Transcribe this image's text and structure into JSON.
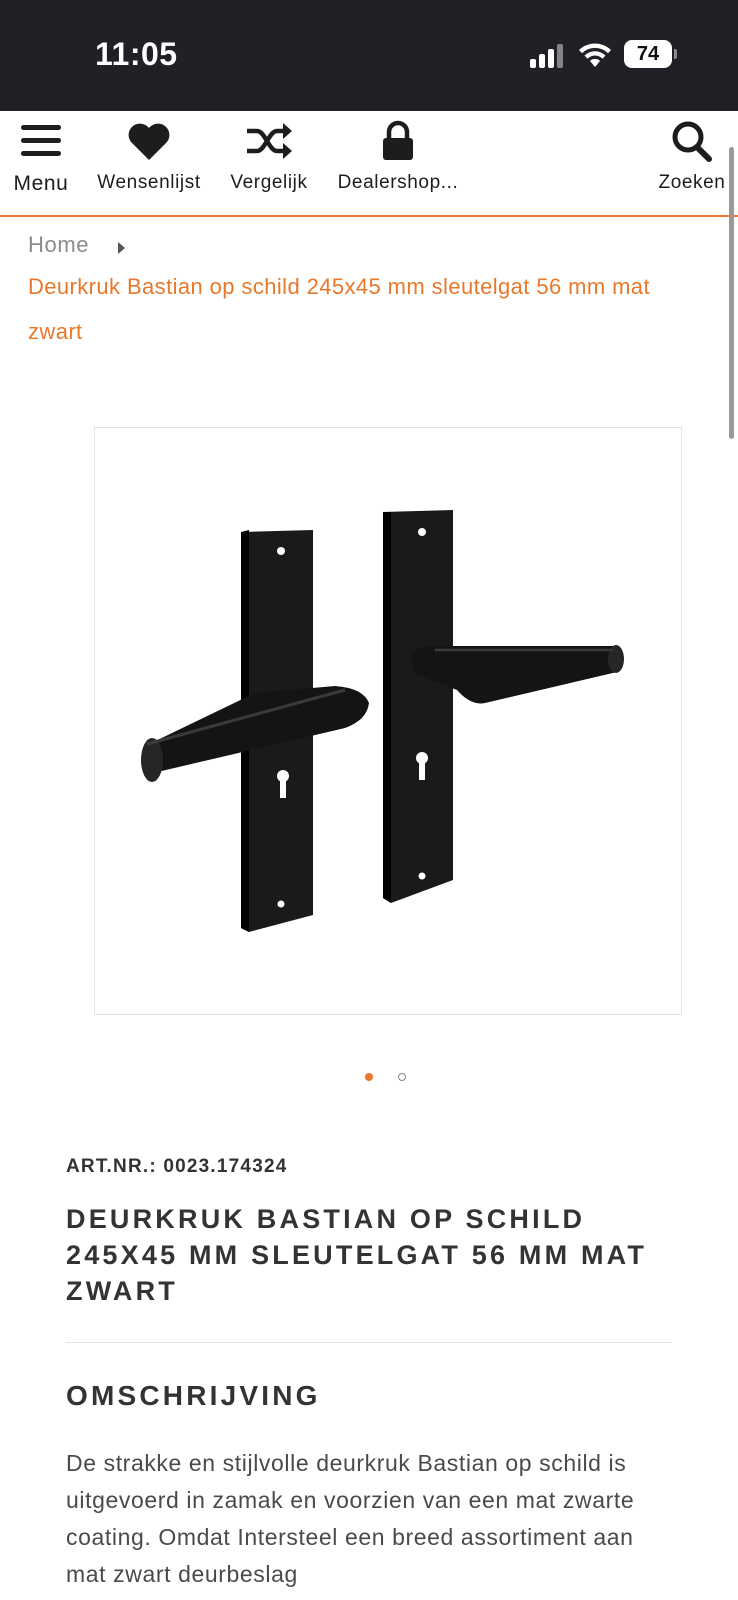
{
  "status_bar": {
    "time": "11:05",
    "battery": "74"
  },
  "nav": {
    "menu": "Menu",
    "wishlist": "Wensenlijst",
    "compare": "Vergelijk",
    "dealershop": "Dealershop...",
    "search": "Zoeken"
  },
  "breadcrumb": {
    "home": "Home",
    "current": "Deurkruk Bastian op schild 245x45 mm sleutelgat 56 mm mat zwart"
  },
  "gallery": {
    "slide_count": 2,
    "active_slide": 1
  },
  "product": {
    "art_nr": "ART.NR.: 0023.174324",
    "title": "DEURKRUK BASTIAN OP SCHILD 245X45 MM SLEUTELGAT 56 MM MAT ZWART"
  },
  "description": {
    "heading": "OMSCHRIJVING",
    "text": "De strakke en stijlvolle deurkruk Bastian op schild is uitgevoerd in zamak en voorzien van een mat zwarte coating. Omdat Intersteel een breed assortiment aan mat zwart deurbeslag"
  },
  "colors": {
    "accent": "#e8782a",
    "statusbar": "#1f2126",
    "text": "#333333"
  }
}
